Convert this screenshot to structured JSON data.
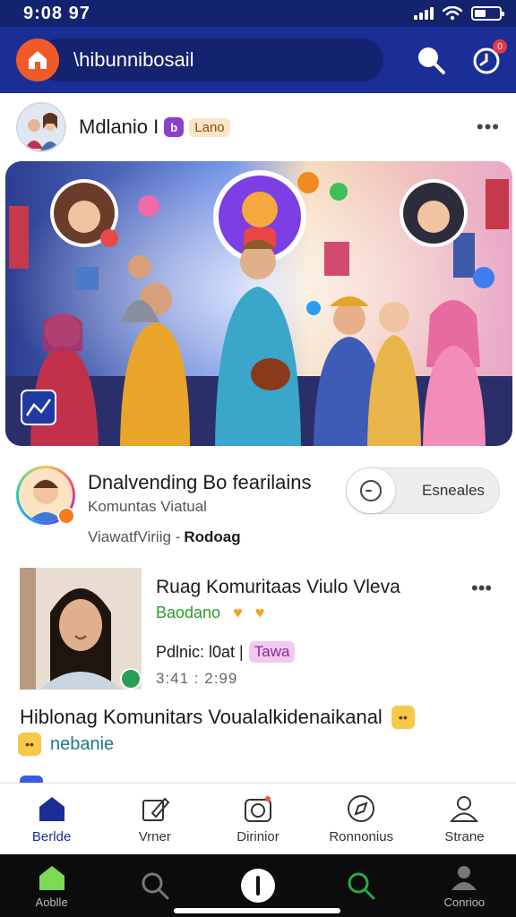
{
  "status_bar": {
    "time": "9:08 97"
  },
  "header": {
    "search_text": "\\hibunnibosail",
    "notification_count": "0",
    "accent_color": "#1a2e96",
    "home_color": "#f05a28"
  },
  "post": {
    "author_name": "Mdlanio I",
    "tag_icon_text": "b",
    "tag_label": "Lano",
    "more": "•••"
  },
  "channel": {
    "title": "Dnalvending Bo fearilains",
    "subtitle": "Komuntas Viatual",
    "meta_left": "ViawatfViriig -",
    "meta_right": "Rodoag",
    "toggle_label": "Esneales"
  },
  "feed_card": {
    "title": "Ruag Komuritaas Viulo Vleva",
    "subtitle": "Baodano",
    "status_label": "Pdlnic: l0at |",
    "status_tag": "Tawa",
    "time": "3:41 : 2:99",
    "more": "•••"
  },
  "headline": {
    "text": "Hiblonag Komunitars Voualalkidenaikanal",
    "subline": "nebanie"
  },
  "bottom_nav": {
    "items": [
      {
        "label": "Berlde",
        "icon": "home-icon"
      },
      {
        "label": "Vrner",
        "icon": "edit-icon"
      },
      {
        "label": "Dirinior",
        "icon": "camera-icon"
      },
      {
        "label": "Ronnonius",
        "icon": "compass-icon"
      },
      {
        "label": "Strane",
        "icon": "profile-icon"
      }
    ]
  },
  "system_nav": {
    "items": [
      {
        "label": "Aoblle",
        "icon": "home-icon"
      },
      {
        "label": "",
        "icon": "search-icon"
      },
      {
        "label": "",
        "icon": "home-button-icon"
      },
      {
        "label": "",
        "icon": "search-icon"
      },
      {
        "label": "Conrioo",
        "icon": "profile-icon"
      }
    ]
  }
}
